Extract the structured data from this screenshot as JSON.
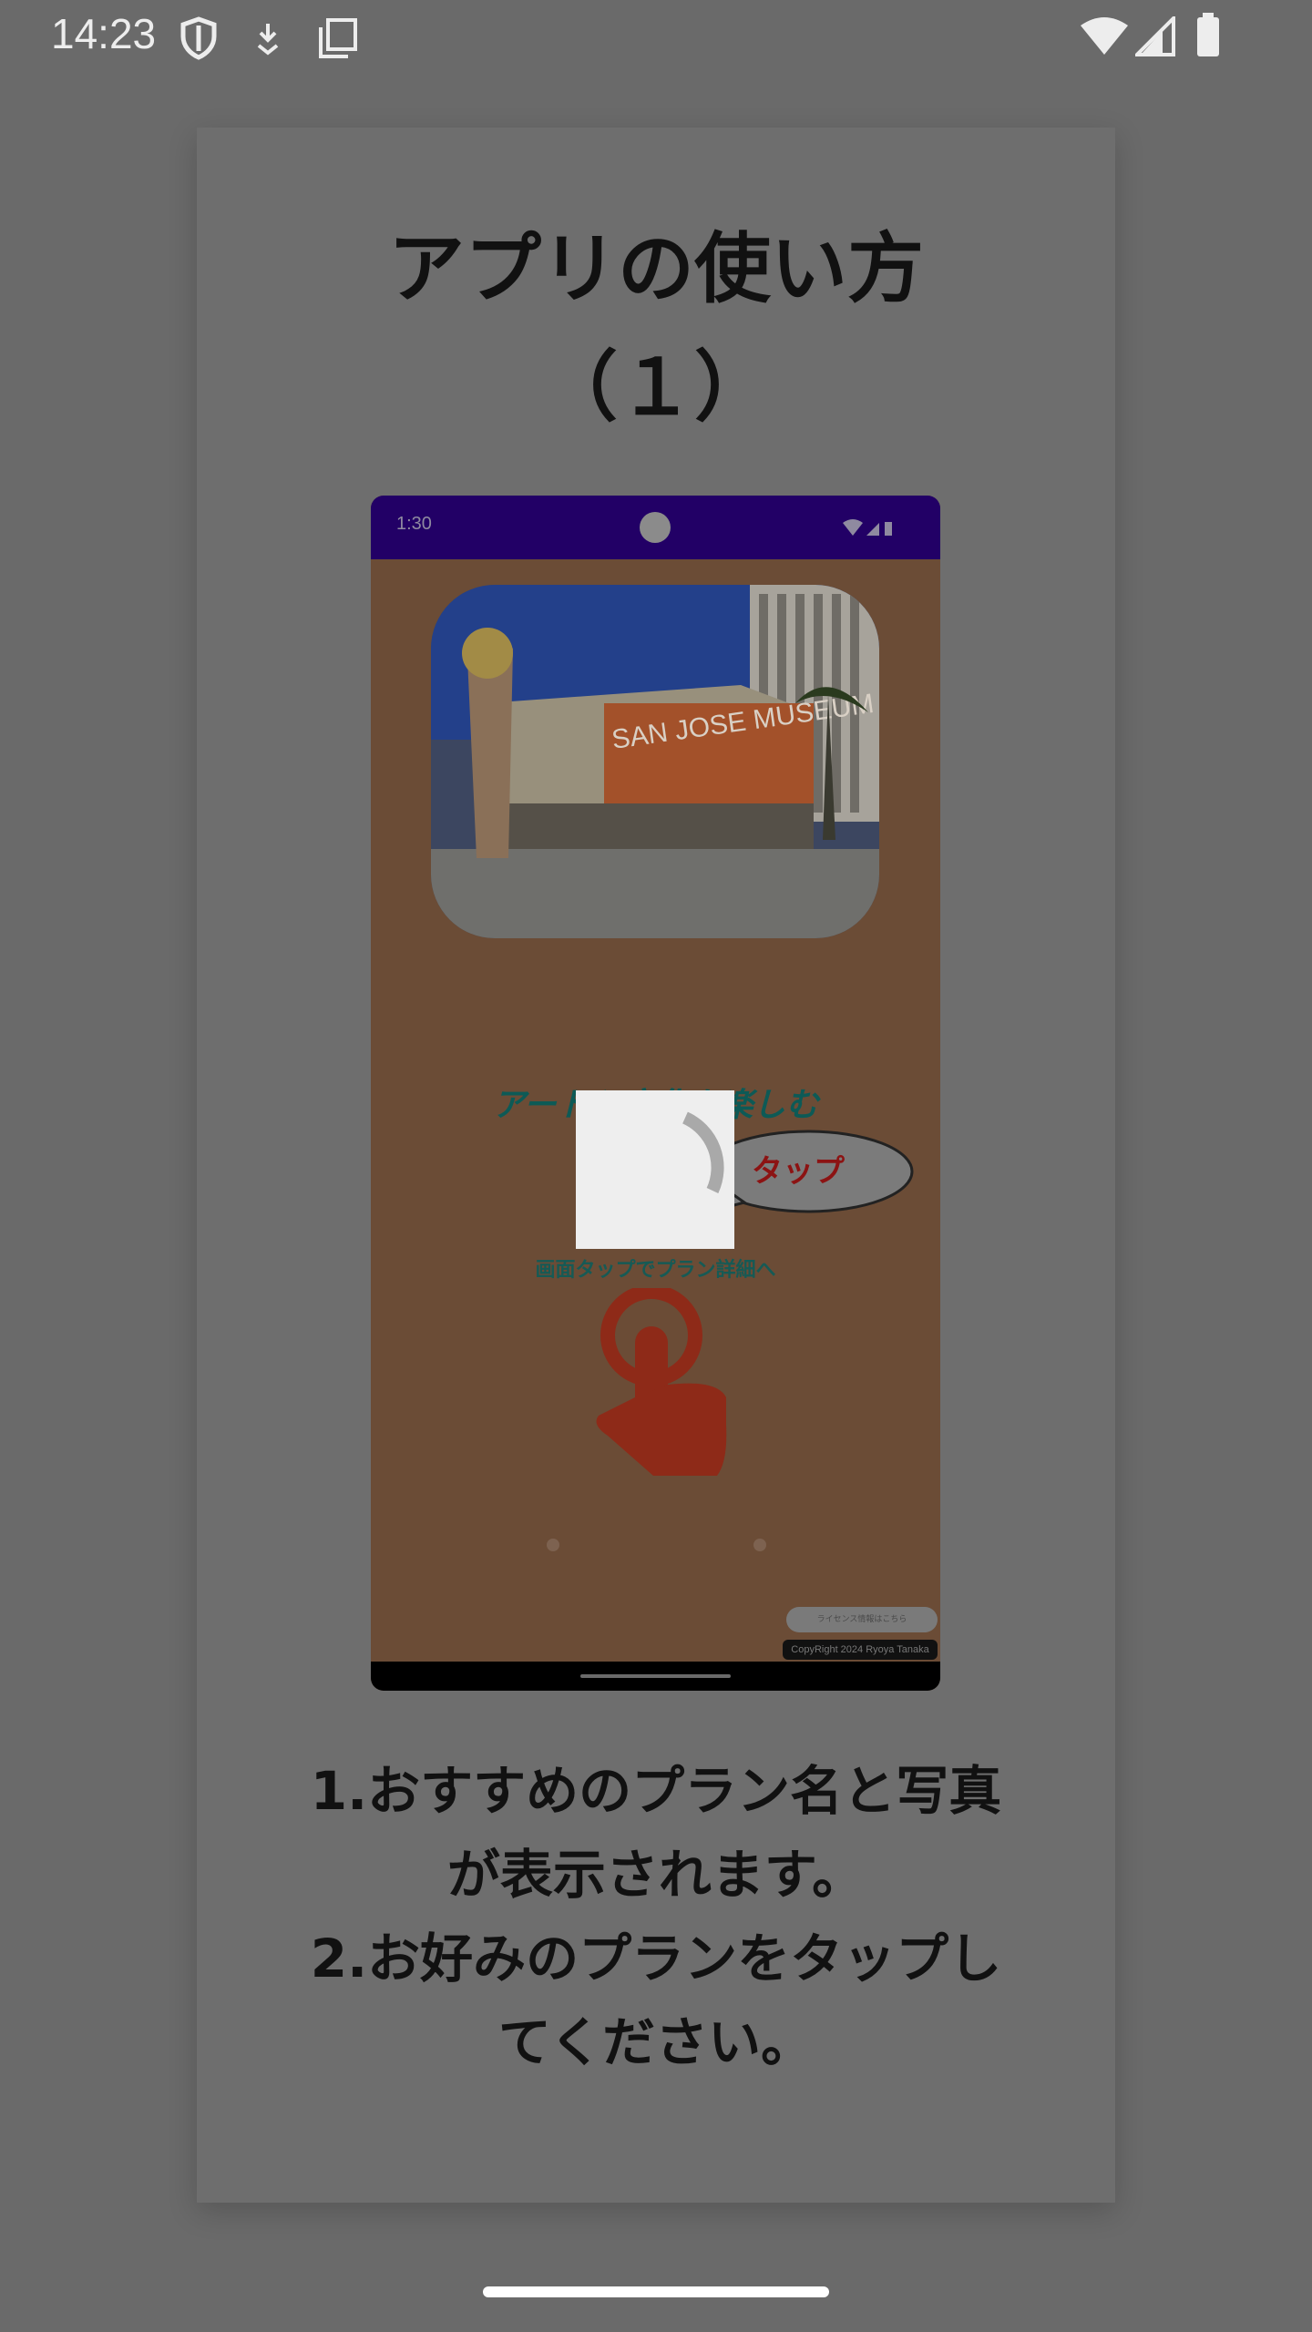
{
  "status_bar": {
    "time": "14:23",
    "left_icons": [
      "shield-icon",
      "download-icon",
      "copy-icon"
    ],
    "right_icons": [
      "wifi-icon",
      "signal-icon",
      "battery-icon"
    ]
  },
  "card": {
    "title_line1": "アプリの使い方",
    "title_line2": "（１）",
    "description_lines": [
      "1.おすすめのプラン名と写真",
      "が表示されます。",
      "2.お好みのプランをタップし",
      "てください。"
    ]
  },
  "preview": {
    "time": "1:30",
    "heading": "アートと文化を楽しむ",
    "bubble": "タップ",
    "subtext": "画面タップでプラン詳細へ",
    "license_button": "ライセンス情報はこちら",
    "copyright": "CopyRight 2024 Ryoya Tanaka",
    "photo_sign": "SAN JOSE MUSEUM OF ART"
  },
  "loading": {
    "state": "spinner"
  },
  "colors": {
    "scrim": "#6a6a6a",
    "preview_status": "#220066",
    "preview_bg": "#6b4c36",
    "accent_hand": "#8e2a18"
  }
}
